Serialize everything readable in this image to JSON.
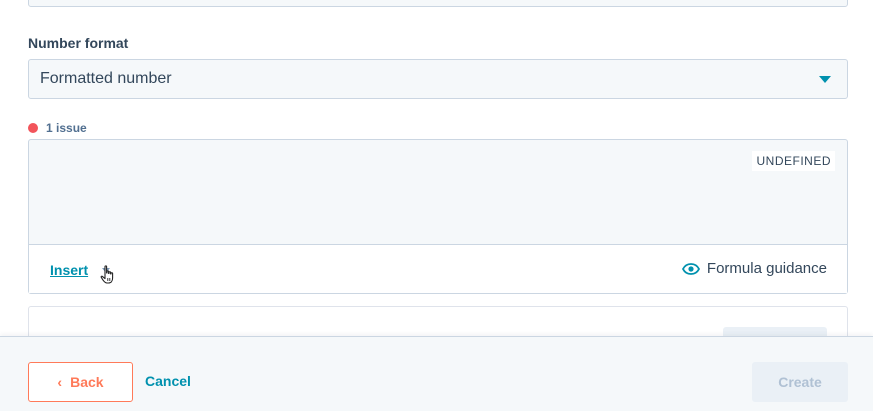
{
  "number_format": {
    "label": "Number format",
    "selected": "Formatted number"
  },
  "issues": {
    "text": "1 issue",
    "color": "#f2545b"
  },
  "formula_editor": {
    "type_badge": "UNDEFINED",
    "insert_label": "Insert",
    "guidance_label": "Formula guidance"
  },
  "footer": {
    "back_label": "Back",
    "cancel_label": "Cancel",
    "create_label": "Create"
  },
  "colors": {
    "accent": "#0091ae",
    "primary_button": "#ff7a59",
    "disabled_bg": "#eaf0f6"
  },
  "icons": {
    "dropdown": "chevron-down-icon",
    "guidance": "eye-icon",
    "back": "chevron-left-icon",
    "cursor": "hand-pointer-icon"
  }
}
